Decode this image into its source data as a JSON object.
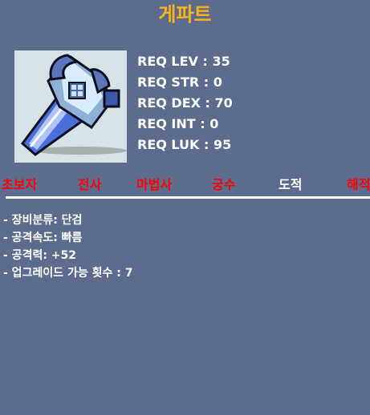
{
  "item": {
    "name": "게파트",
    "icon": "dagger-icon"
  },
  "requirements": [
    {
      "label": "REQ LEV",
      "value": "35",
      "text": "REQ LEV : 35"
    },
    {
      "label": "REQ STR",
      "value": "0",
      "text": "REQ STR : 0"
    },
    {
      "label": "REQ DEX",
      "value": "70",
      "text": "REQ DEX : 70"
    },
    {
      "label": "REQ INT",
      "value": "0",
      "text": "REQ INT : 0"
    },
    {
      "label": "REQ LUK",
      "value": "95",
      "text": "REQ LUK : 95"
    }
  ],
  "jobs": [
    {
      "name": "초보자",
      "color": "#ff0000"
    },
    {
      "name": "전사",
      "color": "#ff0000"
    },
    {
      "name": "마법사",
      "color": "#ff0000"
    },
    {
      "name": "궁수",
      "color": "#ff0000"
    },
    {
      "name": "도적",
      "color": "#ffffff"
    },
    {
      "name": "해적",
      "color": "#ff0000"
    }
  ],
  "stats": [
    "- 장비분류: 단검",
    "- 공격속도: 빠름",
    "- 공격력: +52",
    "- 업그레이드 가능 횟수 : 7"
  ],
  "colors": {
    "background": "#5d6c8d",
    "title": "#ffb21c",
    "job_unavailable": "#ff0000",
    "job_available": "#ffffff",
    "image_background": "#d6e3e6"
  }
}
